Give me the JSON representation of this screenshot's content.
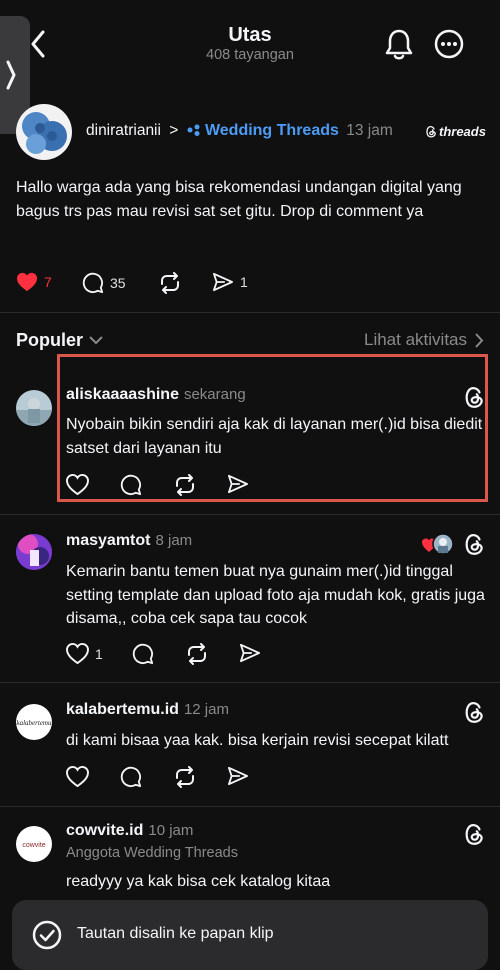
{
  "header": {
    "title": "Utas",
    "views": "408 tayangan"
  },
  "post": {
    "username": "diniratrianii",
    "separator": ">",
    "community": "Wedding Threads",
    "time": "13 jam",
    "brand": "threads",
    "text": "Hallo warga ada yang bisa rekomendasi undangan digital yang bagus trs pas mau revisi sat set gitu. Drop di comment ya",
    "likes": "7",
    "replies": "35",
    "shares": "1"
  },
  "sort": {
    "label": "Populer",
    "activity": "Lihat aktivitas"
  },
  "replies": [
    {
      "username": "aliskaaaashine",
      "time": "sekarang",
      "text": "Nyobain bikin sendiri aja kak di layanan mer(.)id bisa diedit satset dari layanan itu",
      "likes": ""
    },
    {
      "username": "masyamtot",
      "time": "8 jam",
      "text": "Kemarin bantu temen buat nya gunaim mer(.)id tinggal setting template dan upload foto aja mudah kok, gratis juga disama,, coba cek sapa tau cocok",
      "likes": "1"
    },
    {
      "username": "kalabertemu.id",
      "time": "12 jam",
      "text": "di kami bisaa yaa kak. bisa kerjain revisi secepat kilatt",
      "likes": "",
      "avatar_label": "kalabertemu"
    },
    {
      "username": "cowvite.id",
      "time": "10 jam",
      "subtitle": "Anggota Wedding Threads",
      "text": "readyyy ya kak bisa cek katalog kitaa",
      "avatar_label": "cowvite"
    }
  ],
  "toast": {
    "message": "Tautan disalin ke papan klip"
  },
  "colors": {
    "background": "#101010",
    "community_blue": "#4c9cf5",
    "like_red": "#ff3040",
    "highlight_box": "#d9574b"
  }
}
